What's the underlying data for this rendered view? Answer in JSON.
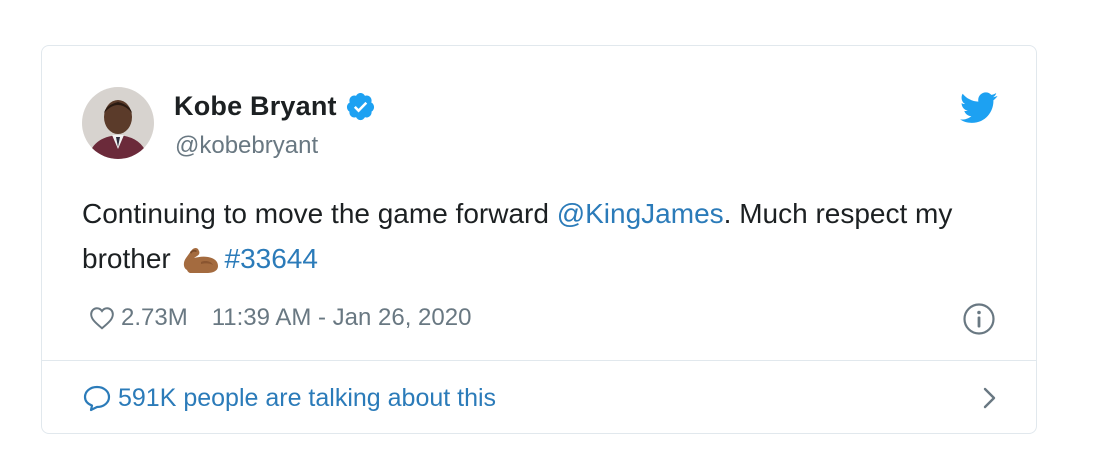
{
  "author": {
    "name": "Kobe Bryant",
    "handle": "@kobebryant",
    "verified": true,
    "avatar_icon": "avatar-photo"
  },
  "tweet": {
    "text_part1": "Continuing to move the game forward ",
    "mention": "@KingJames",
    "text_part2": ". Much respect my brother ",
    "emoji": "flexed-biceps",
    "hashtag": "#33644"
  },
  "meta": {
    "likes": "2.73M",
    "timestamp": "11:39 AM - Jan 26, 2020"
  },
  "footer": {
    "talk_label": "591K people are talking about this"
  },
  "colors": {
    "link": "#2b7bb9",
    "twitter_blue": "#1da1f2",
    "muted": "#697882",
    "border": "#e1e8ed"
  }
}
